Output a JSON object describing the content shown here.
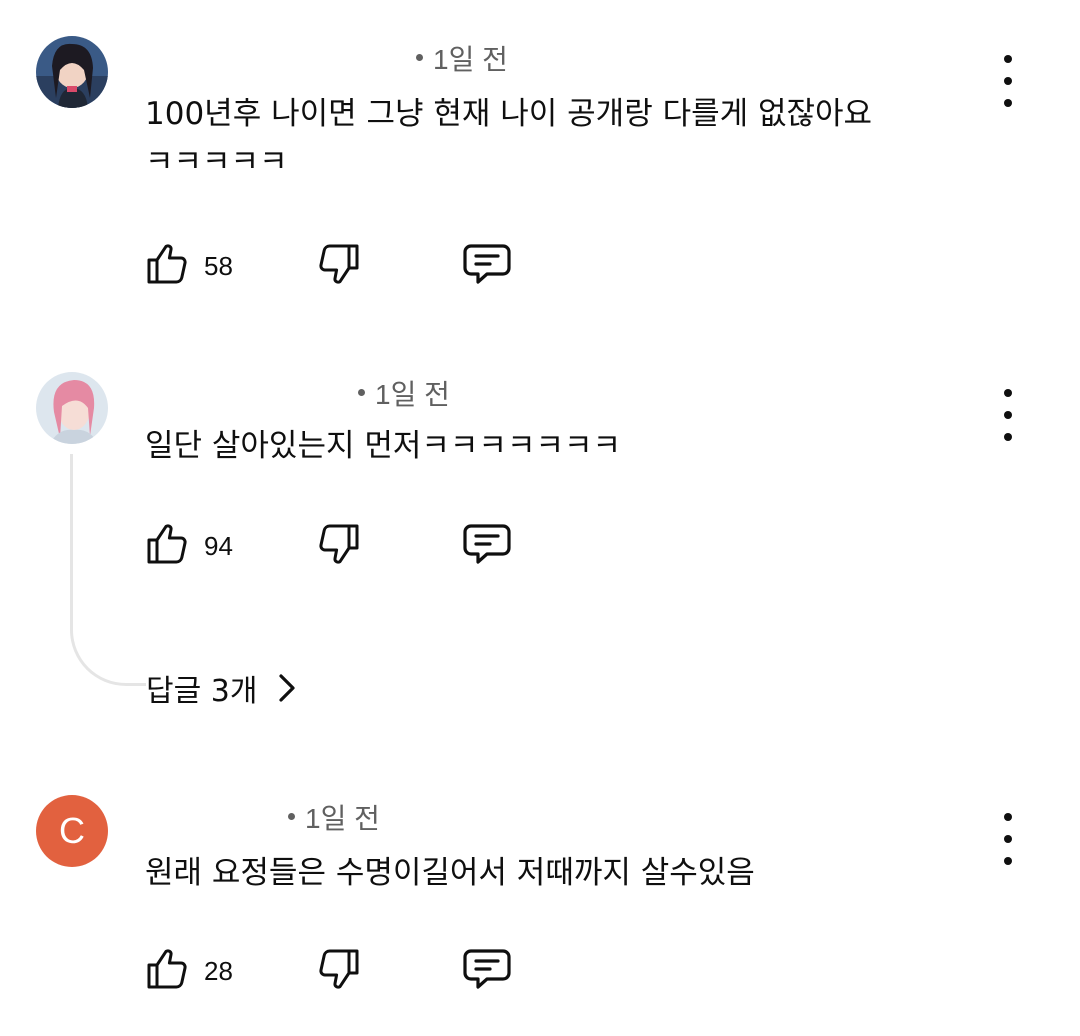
{
  "comments": [
    {
      "time": "1일 전",
      "text": "100년후 나이면 그냥 현재 나이 공개랑 다를게 없잖아요\nㅋㅋㅋㅋㅋ",
      "likes": "58",
      "avatar_icon": "user-avatar-photo"
    },
    {
      "time": "1일 전",
      "text": "일단 살아있는지 먼저ㅋㅋㅋㅋㅋㅋㅋ",
      "likes": "94",
      "avatar_icon": "user-avatar-photo",
      "replies_label": "답글 3개"
    },
    {
      "time": "1일 전",
      "text": "원래 요정들은 수명이길어서 저때까지 살수있음",
      "likes": "28",
      "avatar_letter": "C",
      "avatar_color": "#e2613f"
    }
  ],
  "icons": {
    "like": "thumbs-up-icon",
    "dislike": "thumbs-down-icon",
    "reply": "reply-comment-icon",
    "more": "more-vertical-icon",
    "chevron": "chevron-right-icon"
  }
}
